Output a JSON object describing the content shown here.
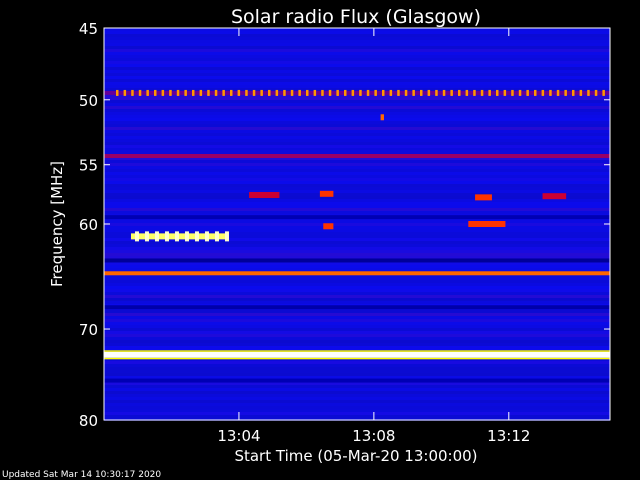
{
  "chart_data": {
    "type": "heatmap",
    "title": "Solar radio Flux (Glasgow)",
    "xlabel": "Start Time (05-Mar-20 13:00:00)",
    "ylabel": "Frequency [MHz]",
    "xlim_minutes": [
      0,
      15
    ],
    "ylim": [
      45,
      80
    ],
    "y_scale": "log",
    "y_ticks": [
      {
        "value": 45,
        "label": "45"
      },
      {
        "value": 50,
        "label": "50"
      },
      {
        "value": 55,
        "label": "55"
      },
      {
        "value": 60,
        "label": "60"
      },
      {
        "value": 70,
        "label": "70"
      },
      {
        "value": 80,
        "label": "80"
      }
    ],
    "x_ticks": [
      {
        "minute": 4,
        "label": "13:04"
      },
      {
        "minute": 8,
        "label": "13:08"
      },
      {
        "minute": 12,
        "label": "13:12"
      }
    ],
    "colormap": [
      "#000080",
      "#0000ff",
      "#ff0000",
      "#ffff00",
      "#ffffff"
    ],
    "background_color": "#1a1ad8",
    "grid": false,
    "features": [
      {
        "kind": "band",
        "freq_mhz": 49.5,
        "intensity": 0.65,
        "dashed": true
      },
      {
        "kind": "band",
        "freq_mhz": 54.3,
        "intensity": 0.4
      },
      {
        "kind": "band",
        "freq_mhz": 64.5,
        "intensity": 0.6
      },
      {
        "kind": "band",
        "freq_mhz": 72.7,
        "intensity": 1.0
      },
      {
        "kind": "band",
        "freq_mhz": 63.3,
        "intensity": 0.05
      },
      {
        "kind": "band",
        "freq_mhz": 67.8,
        "intensity": 0.08
      },
      {
        "kind": "band",
        "freq_mhz": 75.5,
        "intensity": 0.1
      },
      {
        "kind": "band",
        "freq_mhz": 59.4,
        "intensity": 0.1
      },
      {
        "kind": "burst",
        "t_start": 0.8,
        "t_end": 3.6,
        "freq_mhz": 61.1,
        "intensity": 0.85
      },
      {
        "kind": "burst",
        "t_start": 4.3,
        "t_end": 5.2,
        "freq_mhz": 57.5,
        "intensity": 0.45
      },
      {
        "kind": "burst",
        "t_start": 6.4,
        "t_end": 6.8,
        "freq_mhz": 57.4,
        "intensity": 0.55
      },
      {
        "kind": "burst",
        "t_start": 6.5,
        "t_end": 6.8,
        "freq_mhz": 60.2,
        "intensity": 0.55
      },
      {
        "kind": "burst",
        "t_start": 8.2,
        "t_end": 8.3,
        "freq_mhz": 51.3,
        "intensity": 0.6
      },
      {
        "kind": "burst",
        "t_start": 11.0,
        "t_end": 11.5,
        "freq_mhz": 57.7,
        "intensity": 0.55
      },
      {
        "kind": "burst",
        "t_start": 10.8,
        "t_end": 11.9,
        "freq_mhz": 60.0,
        "intensity": 0.55
      },
      {
        "kind": "burst",
        "t_start": 13.0,
        "t_end": 13.7,
        "freq_mhz": 57.6,
        "intensity": 0.45
      }
    ]
  },
  "footer": {
    "updated": "Updated Sat Mar 14 10:30:17 2020"
  }
}
